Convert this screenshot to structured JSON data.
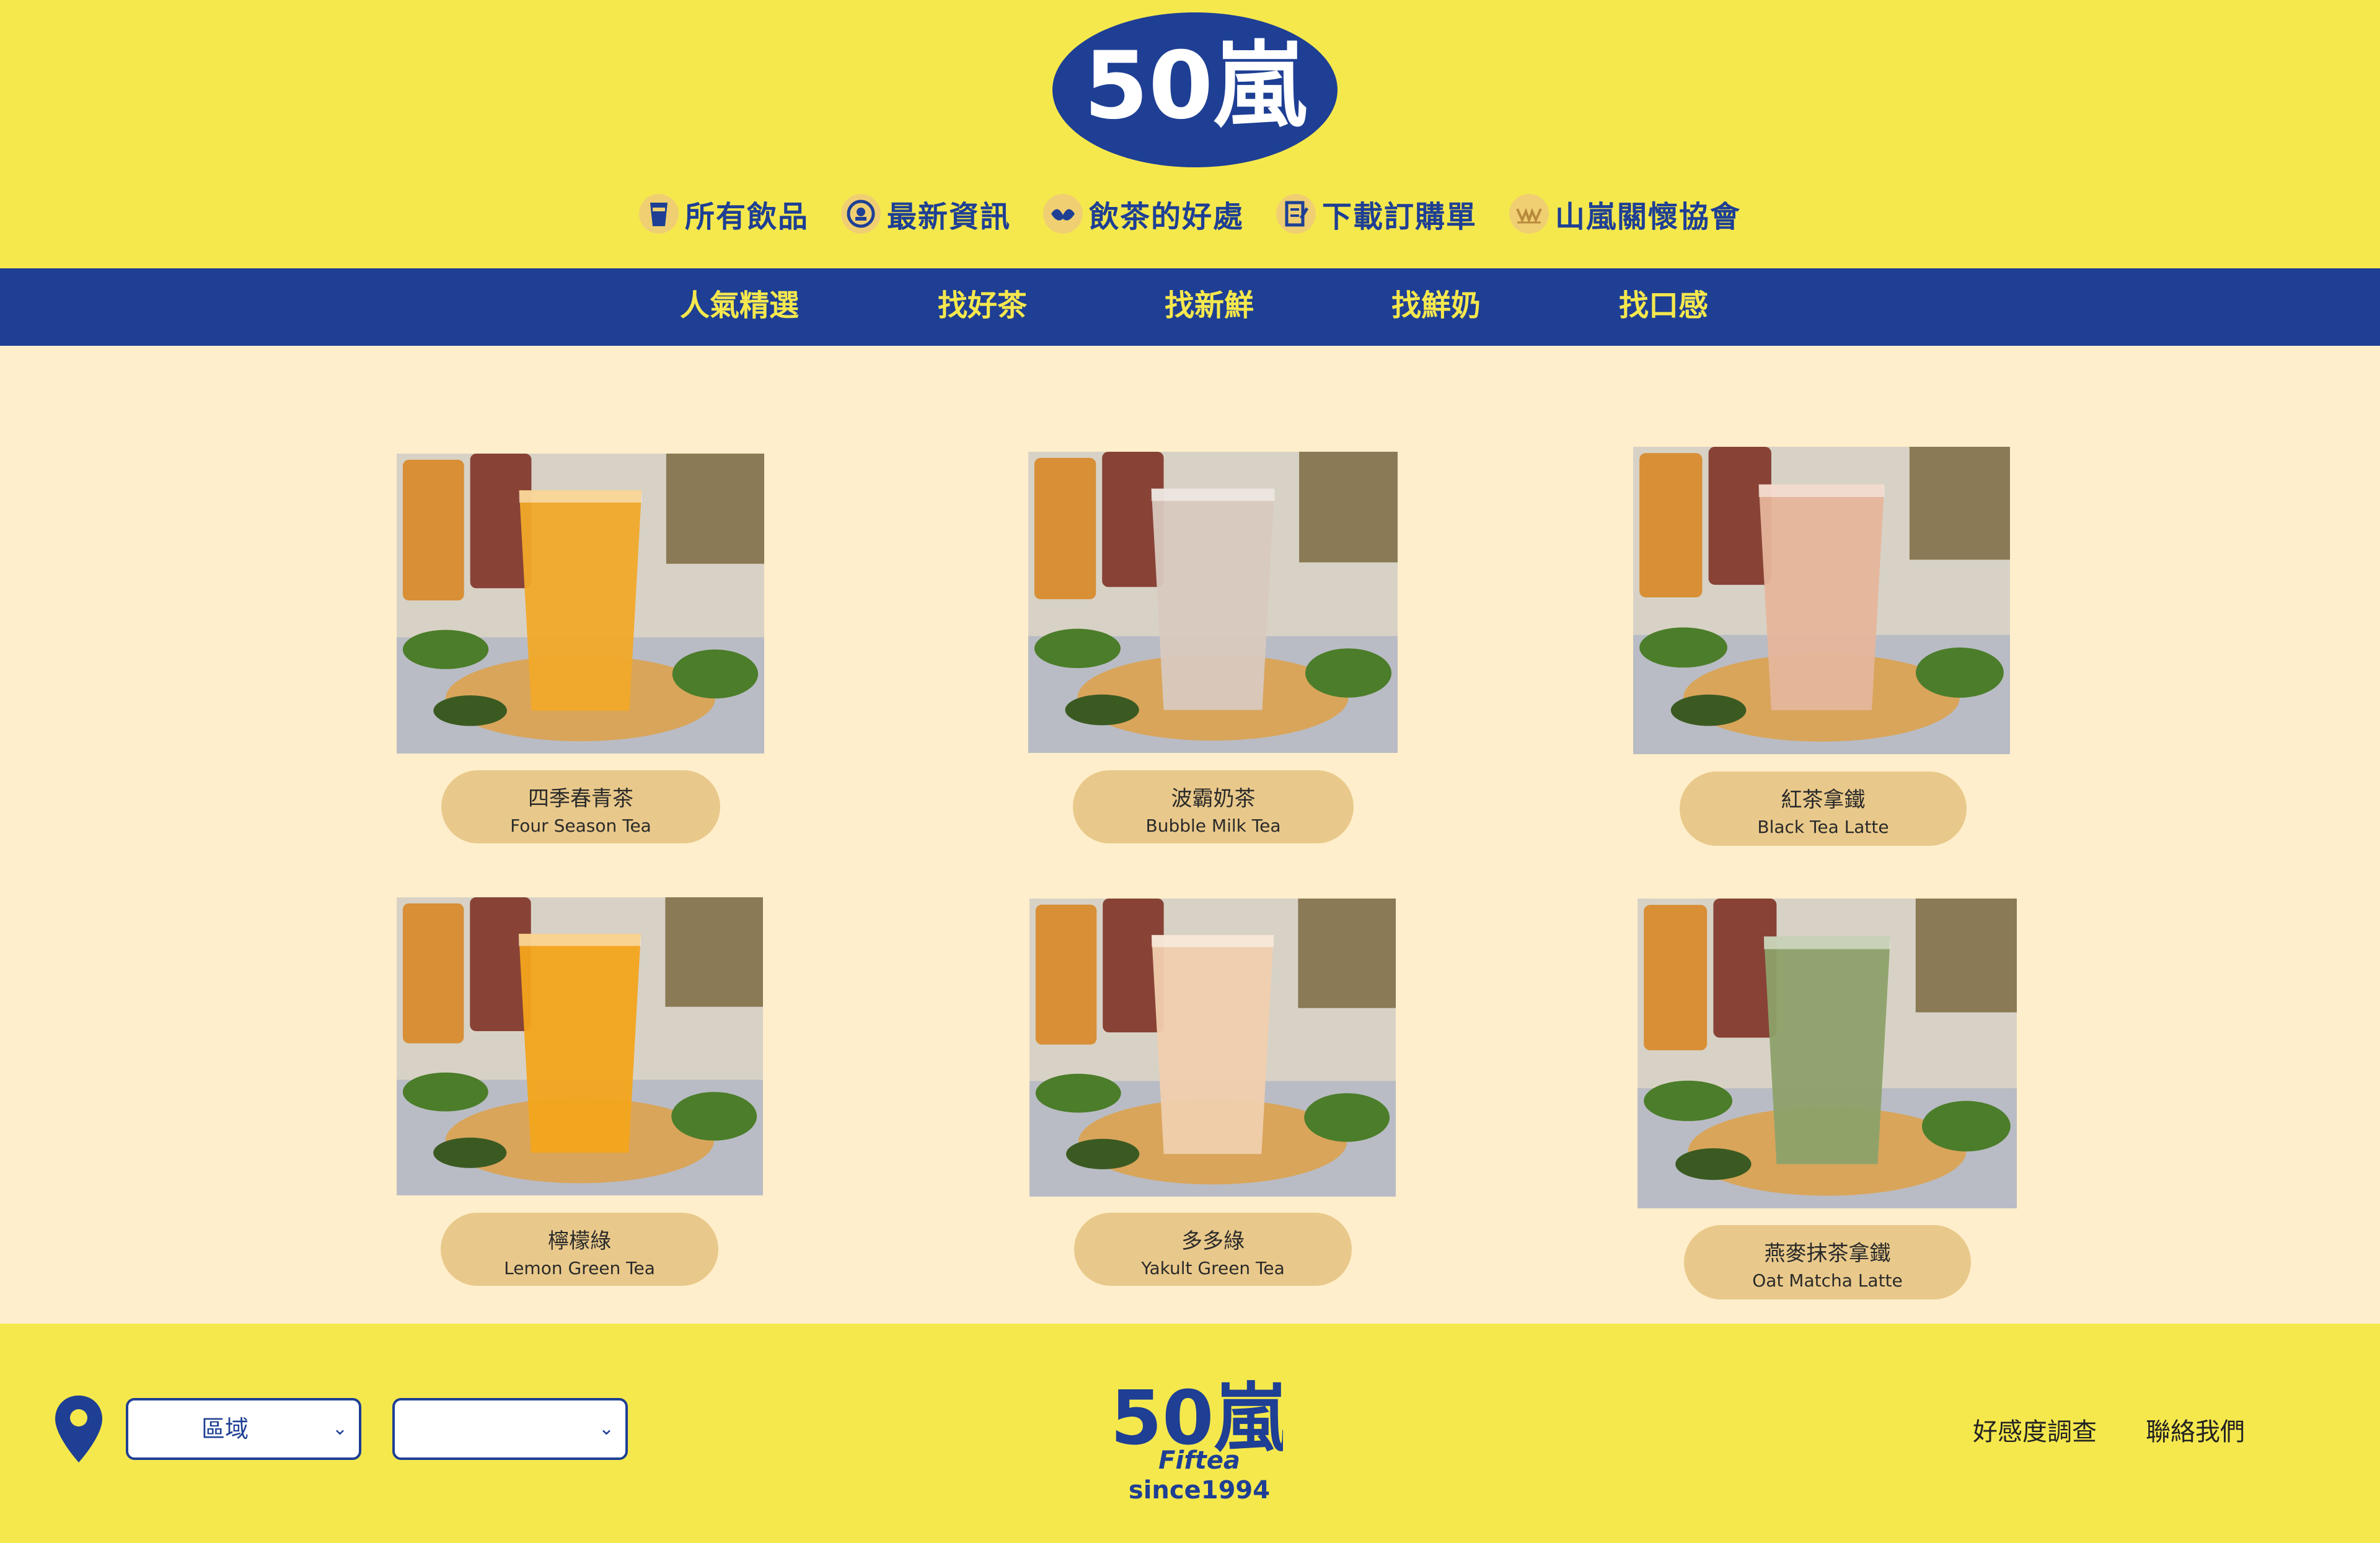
{
  "brand": {
    "logo_text": "50嵐",
    "footer_logo_text": "50嵐",
    "footer_logo_sub": "Fiftea",
    "since": "since1994"
  },
  "colors": {
    "yellow": "#f5e84d",
    "blue": "#1e3f94",
    "cream": "#ffeecb",
    "pill": "#e9c98b"
  },
  "top_nav": [
    {
      "label": "所有飲品",
      "icon": "cup-icon"
    },
    {
      "label": "最新資訊",
      "icon": "news-icon"
    },
    {
      "label": "飲茶的好處",
      "icon": "leaf-icon"
    },
    {
      "label": "下載訂購單",
      "icon": "order-form-icon"
    },
    {
      "label": "山嵐關懷協會",
      "icon": "care-icon"
    }
  ],
  "categories": [
    "人氣精選",
    "找好茶",
    "找新鮮",
    "找鮮奶",
    "找口感"
  ],
  "products": [
    {
      "zh": "四季春青茶",
      "en": "Four Season Tea",
      "drink": "#f1a92a"
    },
    {
      "zh": "波霸奶茶",
      "en": "Bubble Milk Tea",
      "drink": "#d9c9bf"
    },
    {
      "zh": "紅茶拿鐵",
      "en": "Black Tea Latte",
      "drink": "#e6b59b"
    },
    {
      "zh": "檸檬綠",
      "en": "Lemon Green Tea",
      "drink": "#f3a41c"
    },
    {
      "zh": "多多綠",
      "en": "Yakult Green Tea",
      "drink": "#f0cfae"
    },
    {
      "zh": "燕麥抹茶拿鐵",
      "en": "Oat Matcha Latte",
      "drink": "#8da16a"
    }
  ],
  "footer": {
    "region_select": {
      "value": "區域"
    },
    "store_select": {
      "value": ""
    },
    "links": [
      "好感度調查",
      "聯絡我們"
    ]
  }
}
